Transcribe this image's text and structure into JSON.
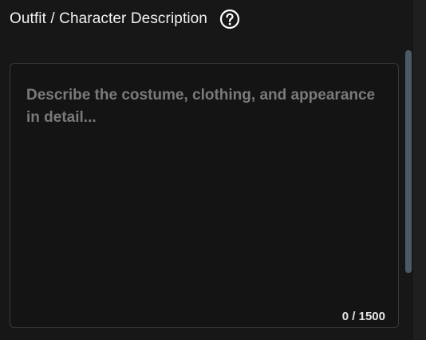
{
  "field": {
    "title": "Outfit / Character Description",
    "help_icon": "question-circle-icon",
    "placeholder": "Describe the costume, clothing, and appearance in detail...",
    "value": "",
    "counter": "0 / 1500"
  },
  "colors": {
    "background": "#171717",
    "border": "#3a3a3a",
    "title": "#f2f2f2",
    "placeholder": "#7a7a7a",
    "scroll_thumb": "#4b5a66"
  }
}
